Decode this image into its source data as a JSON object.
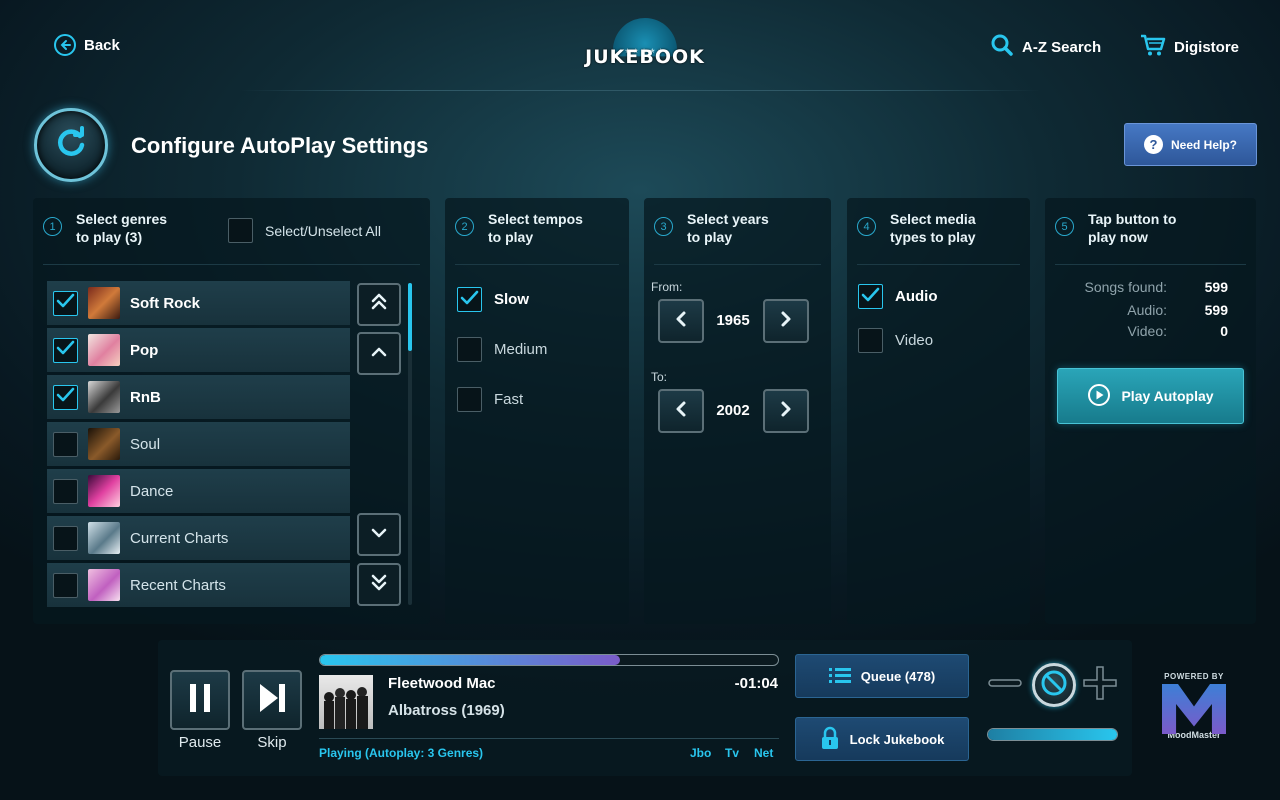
{
  "header": {
    "back_label": "Back",
    "logo_text": "JUKEBOOK",
    "logo_stars": "★★★★★",
    "search_label": "A-Z Search",
    "digistore_label": "Digistore"
  },
  "page": {
    "title": "Configure AutoPlay Settings",
    "help_label": "Need Help?"
  },
  "genres": {
    "step": "1",
    "title_line1": "Select genres",
    "title_line2": "to play (3)",
    "select_all_label": "Select/Unselect All",
    "select_all_checked": false,
    "items": [
      {
        "label": "Soft Rock",
        "checked": true
      },
      {
        "label": "Pop",
        "checked": true
      },
      {
        "label": "RnB",
        "checked": true
      },
      {
        "label": "Soul",
        "checked": false
      },
      {
        "label": "Dance",
        "checked": false
      },
      {
        "label": "Current Charts",
        "checked": false
      },
      {
        "label": "Recent Charts",
        "checked": false
      }
    ]
  },
  "tempos": {
    "step": "2",
    "title_line1": "Select tempos",
    "title_line2": "to play",
    "items": [
      {
        "label": "Slow",
        "checked": true
      },
      {
        "label": "Medium",
        "checked": false
      },
      {
        "label": "Fast",
        "checked": false
      }
    ]
  },
  "years": {
    "step": "3",
    "title_line1": "Select years",
    "title_line2": "to play",
    "from_label": "From:",
    "from_value": "1965",
    "to_label": "To:",
    "to_value": "2002"
  },
  "media": {
    "step": "4",
    "title_line1": "Select media",
    "title_line2": "types to play",
    "items": [
      {
        "label": "Audio",
        "checked": true
      },
      {
        "label": "Video",
        "checked": false
      }
    ]
  },
  "play": {
    "step": "5",
    "title_line1": "Tap button to",
    "title_line2": "play now",
    "songs_found_label": "Songs found:",
    "songs_found_value": "599",
    "audio_label": "Audio:",
    "audio_value": "599",
    "video_label": "Video:",
    "video_value": "0",
    "button_label": "Play Autoplay"
  },
  "player": {
    "pause_label": "Pause",
    "skip_label": "Skip",
    "progress": 0.655,
    "artist": "Fleetwood Mac",
    "track": "Albatross (1969)",
    "time": "-01:04",
    "status": "Playing (Autoplay: 3 Genres)",
    "tags": [
      "Jbo",
      "Tv",
      "Net"
    ],
    "queue_label": "Queue (478)",
    "lock_label": "Lock Jukebook",
    "volume": 1.0,
    "powered_by": "POWERED BY",
    "brand": "MoodMaster"
  },
  "colors": {
    "accent": "#29c6ee",
    "help_button": "#3a68b0",
    "play_button": "#1f94a6",
    "queue_button": "#1b436a",
    "progress_end": "#7a5cc9"
  },
  "icons": {
    "back": "arrow-left-circle-icon",
    "search": "magnifier-icon",
    "digistore": "cart-icon",
    "autoplay": "refresh-icon",
    "help": "question-icon",
    "queue": "list-icon",
    "lock": "padlock-icon",
    "mute": "mute-icon"
  }
}
